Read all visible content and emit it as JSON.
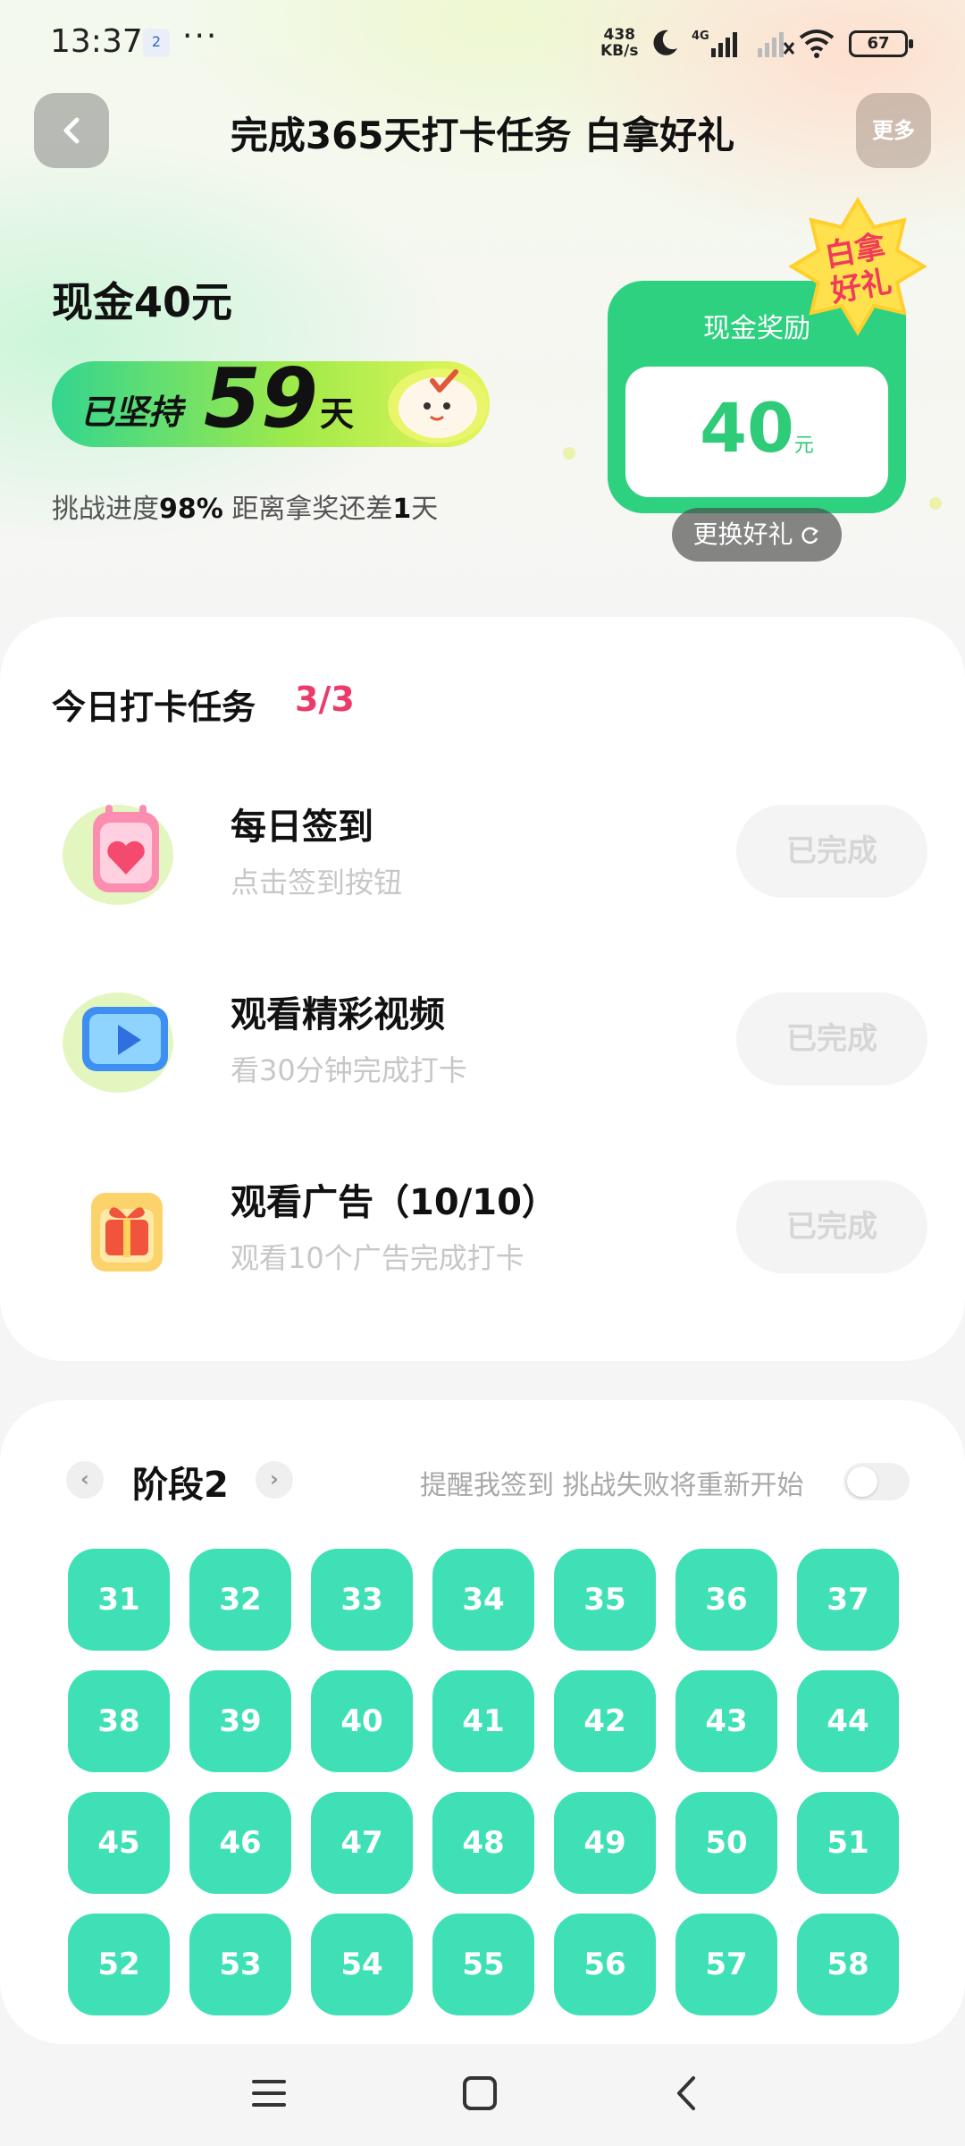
{
  "status_bar": {
    "time": "13:37",
    "notif_badge": "2",
    "dots": "···",
    "speed_top": "438",
    "speed_unit": "KB/s",
    "battery": "67"
  },
  "header": {
    "title": "完成365天打卡任务 白拿好礼",
    "more_label": "更多"
  },
  "summary": {
    "cash_title": "现金40元",
    "persist_prefix": "已坚持",
    "persist_days": "59",
    "persist_suffix": "天",
    "progress_prefix": "挑战进度",
    "progress_pct": "98%",
    "progress_mid": " 距离拿奖还差",
    "days_left": "1",
    "progress_suffix": "天"
  },
  "reward": {
    "title": "现金奖励",
    "value": "40",
    "unit": "元",
    "badge_line1": "白拿",
    "badge_line2": "好礼",
    "change_label": "更换好礼"
  },
  "tasks": {
    "header": "今日打卡任务",
    "count": "3/3",
    "items": [
      {
        "title": "每日签到",
        "subtitle": "点击签到按钮",
        "button": "已完成"
      },
      {
        "title": "观看精彩视频",
        "subtitle": "看30分钟完成打卡",
        "button": "已完成"
      },
      {
        "title": "观看广告（10/10）",
        "subtitle": "观看10个广告完成打卡",
        "button": "已完成"
      }
    ]
  },
  "stage": {
    "title": "阶段2",
    "prev_glyph": "‹",
    "next_glyph": "›",
    "remind_text": "提醒我签到 挑战失败将重新开始",
    "reminder_on": false,
    "days": [
      "31",
      "32",
      "33",
      "34",
      "35",
      "36",
      "37",
      "38",
      "39",
      "40",
      "41",
      "42",
      "43",
      "44",
      "45",
      "46",
      "47",
      "48",
      "49",
      "50",
      "51",
      "52",
      "53",
      "54",
      "55",
      "56",
      "57",
      "58"
    ]
  },
  "colors": {
    "accent_green": "#2ed17f",
    "day_cell": "#3fe0b6",
    "count_pink": "#ec3a6a",
    "badge_yellow": "#ffe14d",
    "badge_red": "#f03c5a"
  },
  "icons": {
    "back": "chevron-left-icon",
    "refresh": "refresh-icon",
    "checkin": "calendar-heart-icon",
    "video": "play-video-icon",
    "ad": "gift-box-icon"
  }
}
